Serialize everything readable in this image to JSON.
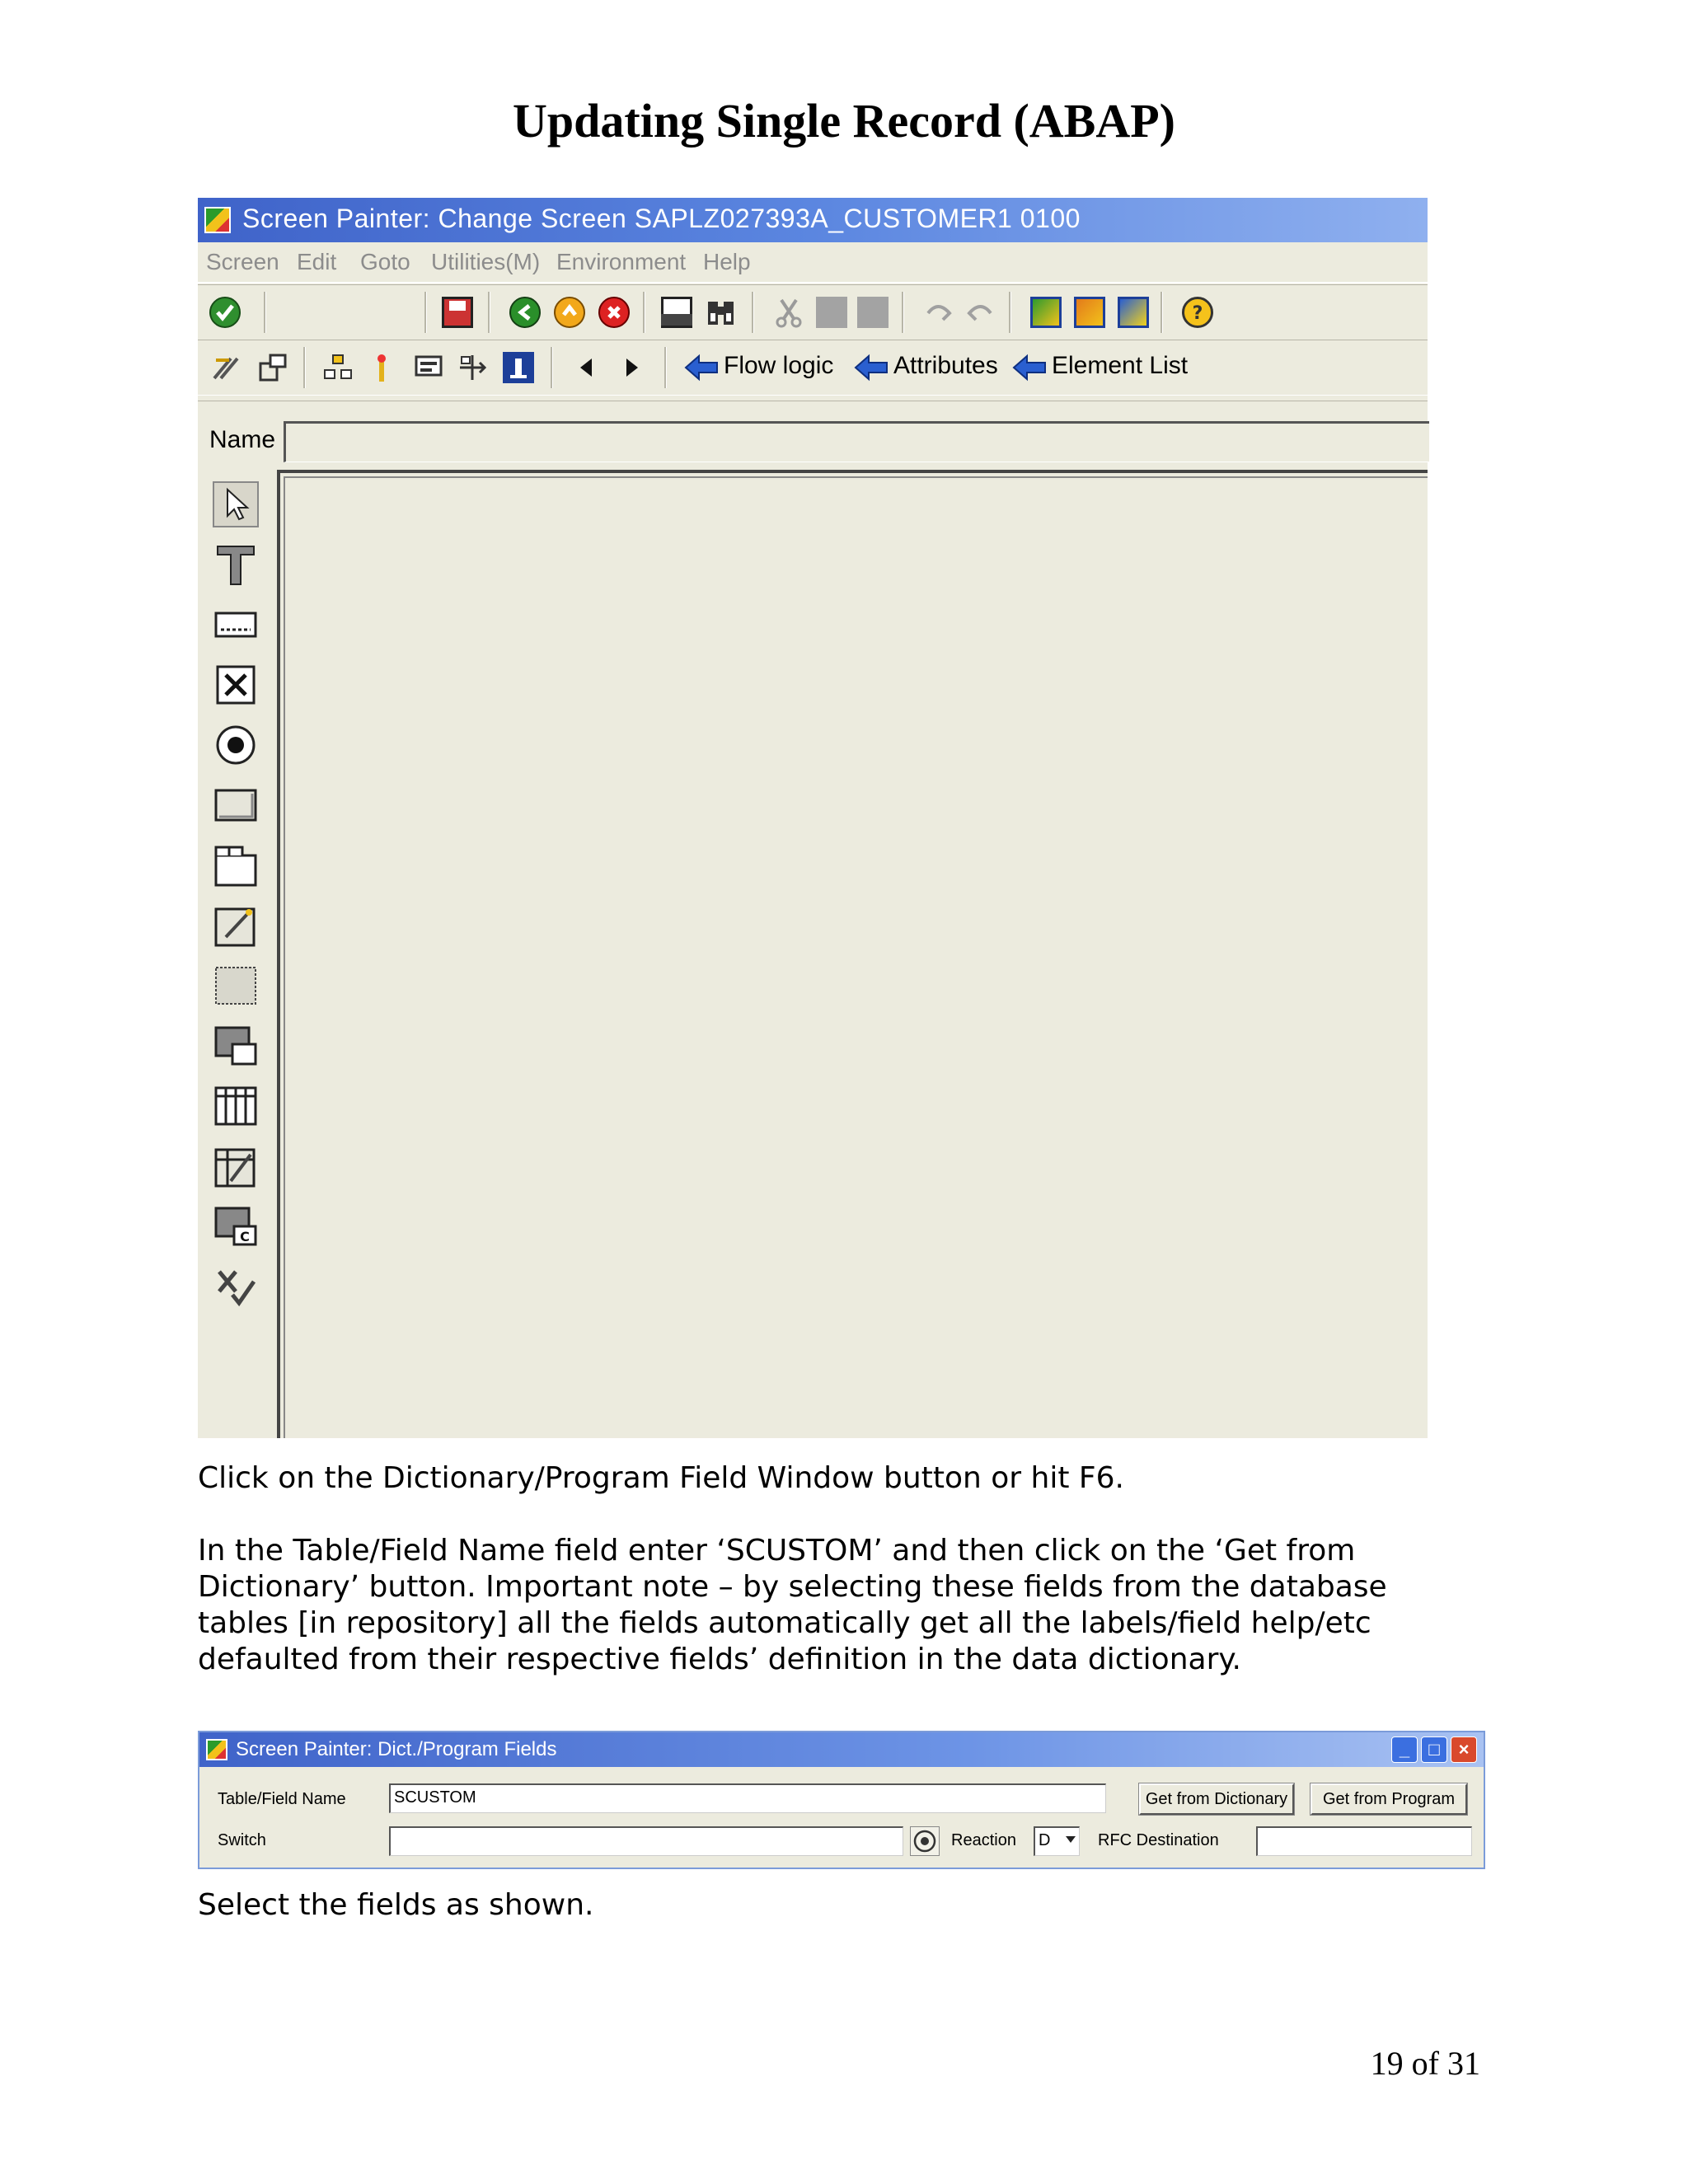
{
  "doc": {
    "title": "Updating Single Record (ABAP)",
    "para1": "Click on the Dictionary/Program Field Window button or hit F6.",
    "para2": "In the Table/Field Name field enter ‘SCUSTOM’ and then click on the ‘Get from Dictionary’ button. Important note – by selecting these fields from the database tables [in repository] all the fields automatically get all the labels/field help/etc defaulted from their respective fields’ definition in the data dictionary.",
    "para3": "Select the fields as shown.",
    "page_number": "19 of 31"
  },
  "screen_painter": {
    "title": "Screen Painter:  Change Screen SAPLZ027393A_CUSTOMER1 0100",
    "menu": [
      "Screen",
      "Edit",
      "Goto",
      "Utilities(M)",
      "Environment",
      "Help"
    ],
    "links": {
      "flow_logic": "Flow logic",
      "attributes": "Attributes",
      "element_list": "Element List"
    },
    "name_label": "Name",
    "name_value": ""
  },
  "dict_fields": {
    "title": "Screen Painter: Dict./Program Fields",
    "table_field_label": "Table/Field Name",
    "table_field_value": "SCUSTOM",
    "get_from_dictionary": "Get from Dictionary",
    "get_from_program": "Get from Program",
    "switch_label": "Switch",
    "switch_value": "",
    "reaction_label": "Reaction",
    "reaction_value": "D",
    "rfc_label": "RFC Destination",
    "rfc_value": ""
  },
  "colors": {
    "titlebar": "#3f63c9",
    "window_bg": "#ecebde",
    "menu_disabled": "#8c8c8c"
  }
}
